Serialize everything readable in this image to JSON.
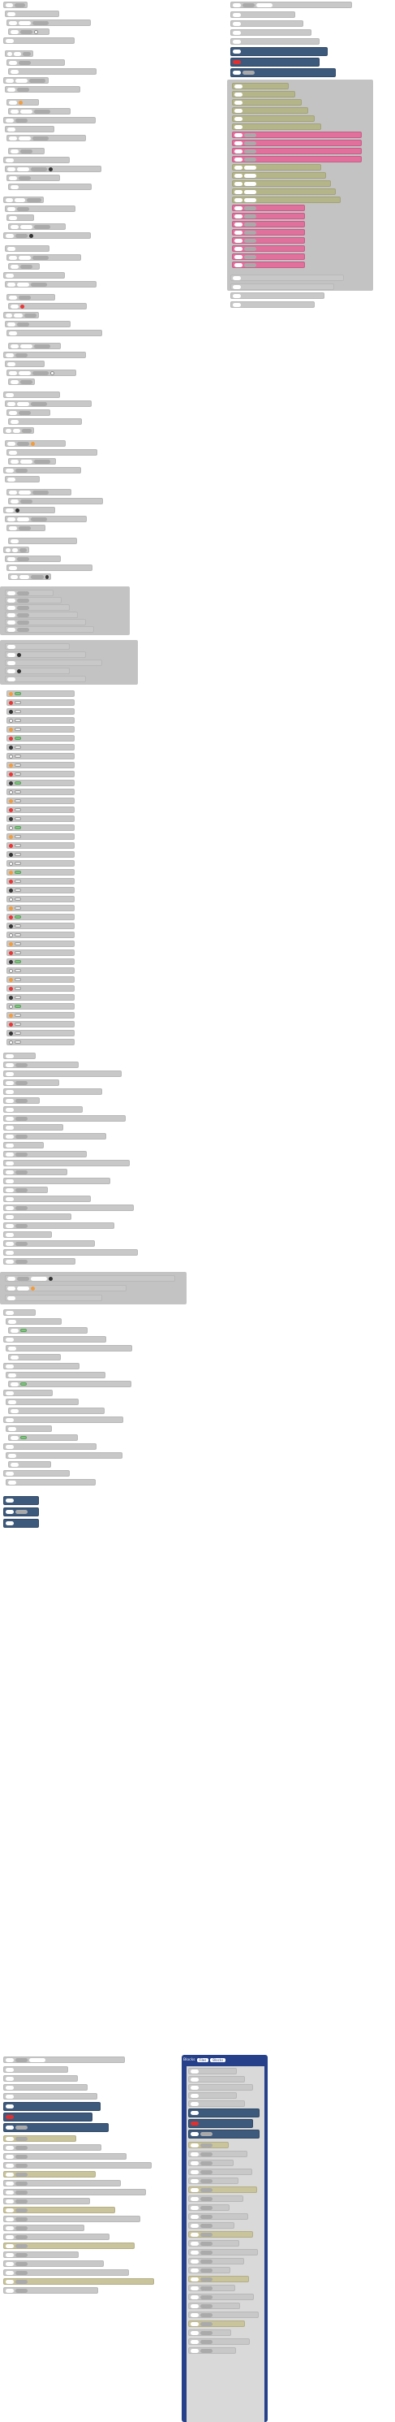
{
  "left": {
    "row_labels": [
      "set",
      "say",
      "set",
      "say",
      "set",
      "say",
      "set",
      "if",
      "set",
      "do",
      "set",
      "say"
    ],
    "pick_label": "pick",
    "drag_label": "drag"
  },
  "right": {
    "top_labels": [
      "go to",
      "pick",
      "set",
      "wait",
      "rotate",
      "repeat",
      "speed",
      "wait"
    ]
  },
  "bottom": {
    "tab_title": "Blocks",
    "tab_a": "Files",
    "tab_b": "Blocks"
  },
  "colors": {
    "block_gray": "#c8c8c8",
    "block_dark": "#3d5a7d",
    "block_olive": "#b5b58a",
    "block_pink": "#e0709c",
    "panel_navy": "#26418a"
  }
}
